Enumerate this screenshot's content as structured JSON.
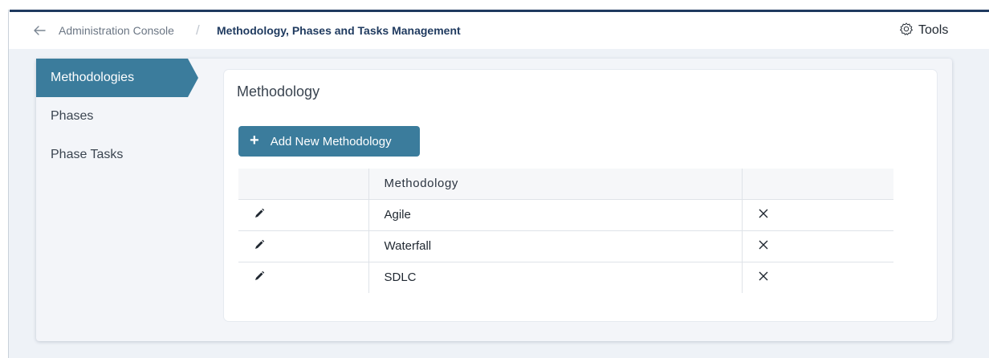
{
  "header": {
    "breadcrumb_parent": "Administration Console",
    "breadcrumb_separator": "/",
    "breadcrumb_current": "Methodology, Phases and Tasks Management",
    "tools_label": "Tools"
  },
  "sidebar": {
    "items": [
      {
        "label": "Methodologies",
        "active": true
      },
      {
        "label": "Phases",
        "active": false
      },
      {
        "label": "Phase Tasks",
        "active": false
      }
    ]
  },
  "main": {
    "title": "Methodology",
    "add_button_label": "Add New Methodology",
    "table": {
      "columns": [
        "",
        "Methodology",
        ""
      ],
      "rows": [
        "Agile",
        "Waterfall",
        "SDLC"
      ]
    }
  },
  "colors": {
    "accent": "#3b7c9c",
    "header_accent": "#1f3a5f",
    "content_bg": "#eef2f7"
  },
  "icons": {
    "back": "arrow-left-icon",
    "tools": "gear-icon",
    "add": "plus-icon",
    "edit": "pencil-icon",
    "delete": "close-icon"
  }
}
